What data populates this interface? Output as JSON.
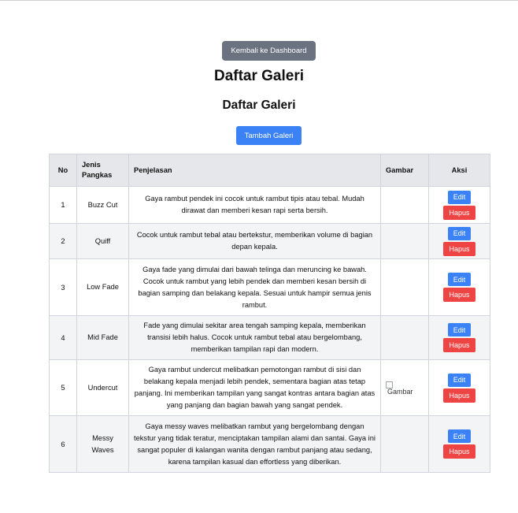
{
  "header": {
    "back_button": "Kembali ke Dashboard",
    "title": "Daftar Galeri",
    "subtitle": "Daftar Galeri",
    "add_button": "Tambah Galeri"
  },
  "table": {
    "columns": [
      "No",
      "Jenis Pangkas",
      "Penjelasan",
      "Gambar",
      "Aksi"
    ],
    "rows": [
      {
        "no": "1",
        "jenis": "Buzz Cut",
        "penjelasan": "Gaya rambut pendek ini cocok untuk rambut tipis atau tebal. Mudah dirawat dan memberi kesan rapi serta bersih.",
        "gambar": ""
      },
      {
        "no": "2",
        "jenis": "Quiff",
        "penjelasan": "Cocok untuk rambut tebal atau bertekstur, memberikan volume di bagian depan kepala.",
        "gambar": ""
      },
      {
        "no": "3",
        "jenis": "Low Fade",
        "penjelasan": "Gaya fade yang dimulai dari bawah telinga dan meruncing ke bawah. Cocok untuk rambut yang lebih pendek dan memberi kesan bersih di bagian samping dan belakang kepala. Sesuai untuk hampir semua jenis rambut.",
        "gambar": ""
      },
      {
        "no": "4",
        "jenis": "Mid Fade",
        "penjelasan": "Fade yang dimulai sekitar area tengah samping kepala, memberikan transisi lebih halus. Cocok untuk rambut tebal atau bergelombang, memberikan tampilan rapi dan modern.",
        "gambar": ""
      },
      {
        "no": "5",
        "jenis": "Undercut",
        "penjelasan": "Gaya rambut undercut melibatkan pemotongan rambut di sisi dan belakang kepala menjadi lebih pendek, sementara bagian atas tetap panjang. Ini memberikan tampilan yang sangat kontras antara bagian atas yang panjang dan bagian bawah yang sangat pendek.",
        "gambar": "Gambar"
      },
      {
        "no": "6",
        "jenis": "Messy Waves",
        "penjelasan": "Gaya messy waves melibatkan rambut yang bergelombang dengan tekstur yang tidak teratur, menciptakan tampilan alami dan santai. Gaya ini sangat populer di kalangan wanita dengan rambut panjang atau sedang, karena tampilan kasual dan effortless yang diberikan.",
        "gambar": ""
      }
    ],
    "edit_label": "Edit",
    "delete_label": "Hapus"
  },
  "colors": {
    "back_button": "#6b7280",
    "primary": "#3b82f6",
    "danger": "#ef4444",
    "header_bg": "#e5e7eb",
    "stripe_bg": "#f3f4f6"
  }
}
